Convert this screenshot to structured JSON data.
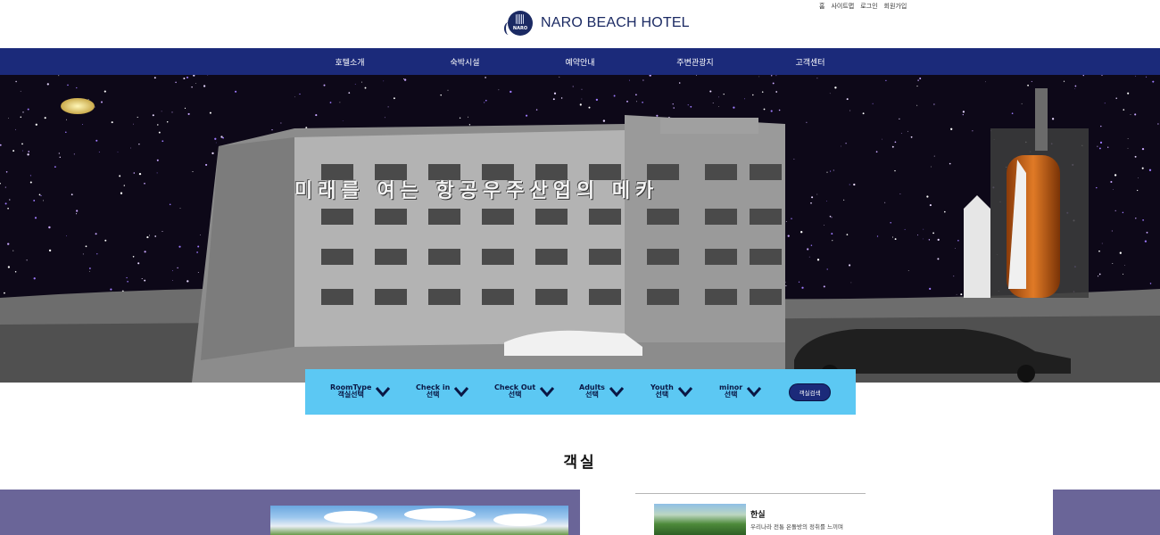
{
  "utility_links": [
    "홈",
    "사이트맵",
    "로그인",
    "회원가입"
  ],
  "logo": {
    "mark_text": "NARO",
    "name": "NARO BEACH HOTEL"
  },
  "nav": [
    {
      "label": "호텔소개"
    },
    {
      "label": "숙박시설"
    },
    {
      "label": "예약안내"
    },
    {
      "label": "주변관광지"
    },
    {
      "label": "고객센터"
    }
  ],
  "hero": {
    "headline": "미래를 여는 항공우주산업의 메카"
  },
  "search": {
    "fields": [
      {
        "label": "RoomType",
        "sub": "객실선택"
      },
      {
        "label": "Check in",
        "sub": "선택"
      },
      {
        "label": "Check Out",
        "sub": "선택"
      },
      {
        "label": "Adults",
        "sub": "선택"
      },
      {
        "label": "Youth",
        "sub": "선택"
      },
      {
        "label": "minor",
        "sub": "선택"
      }
    ],
    "button": "객실검색"
  },
  "section": {
    "title": "객실"
  },
  "room": {
    "name": "한실",
    "desc": "우리나라 전통 온돌방의 정취를 느끼며"
  },
  "colors": {
    "nav": "#1b2a7a",
    "search_bar": "#5cc8f3",
    "purple_band": "#6a6598",
    "brand": "#1b2a63"
  },
  "icons": [
    "chevron-down-icon",
    "logo-icon"
  ]
}
